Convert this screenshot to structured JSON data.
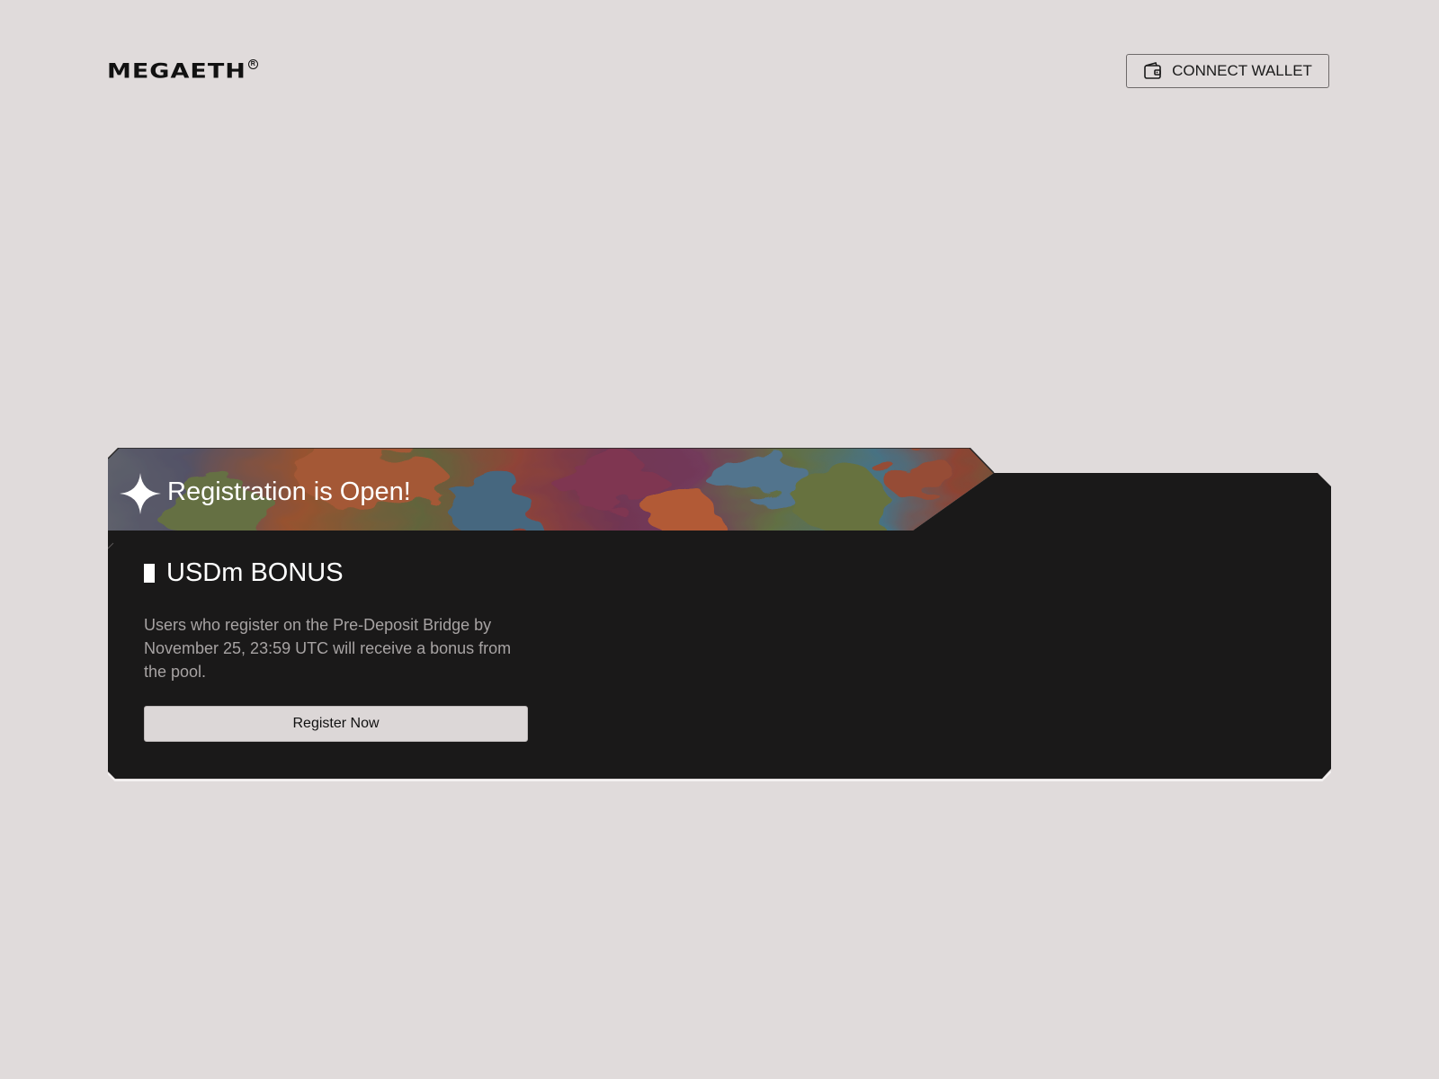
{
  "header": {
    "logo_text": "MEGAETH",
    "logo_mark": "R",
    "connect_wallet_label": "CONNECT WALLET"
  },
  "card": {
    "banner_title": "Registration is Open!",
    "section_title": "USDm BONUS",
    "description": "Users who register on the Pre-Deposit Bridge by November 25, 23:59 UTC will receive a bonus from the pool.",
    "register_label": "Register Now"
  },
  "icons": {
    "wallet": "wallet-icon",
    "sparkle": "sparkle-icon"
  },
  "colors": {
    "page_bg": "#e0dbdb",
    "card_bg": "#1a1919",
    "text_dark": "#111111",
    "text_light": "#ffffff",
    "text_muted": "#a7a3a3",
    "button_bg": "#dcd7d7"
  }
}
